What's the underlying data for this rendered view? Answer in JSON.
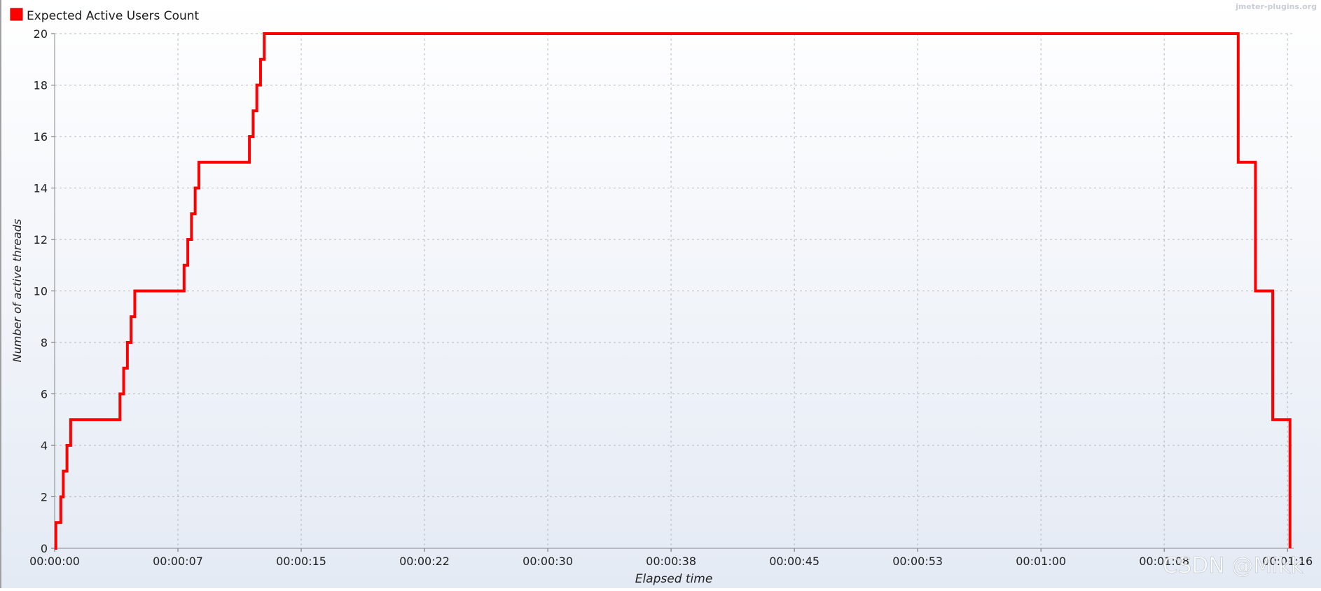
{
  "legend": {
    "label": "Expected Active Users Count",
    "color": "#ff0000"
  },
  "watermark_top": "jmeter-plugins.org",
  "watermark_bottom": "CSDN @Mikk",
  "chart_data": {
    "type": "line",
    "series": [
      {
        "name": "Expected Active Users Count",
        "color": "#ff0000",
        "step": true,
        "points": [
          [
            0,
            0
          ],
          [
            0.1,
            1
          ],
          [
            0.5,
            2
          ],
          [
            0.7,
            3
          ],
          [
            1.0,
            4
          ],
          [
            1.3,
            5
          ],
          [
            5.3,
            6
          ],
          [
            5.6,
            7
          ],
          [
            5.9,
            8
          ],
          [
            6.2,
            9
          ],
          [
            6.5,
            10
          ],
          [
            10.5,
            11
          ],
          [
            10.8,
            12
          ],
          [
            11.1,
            13
          ],
          [
            11.4,
            14
          ],
          [
            11.7,
            15
          ],
          [
            15.8,
            16
          ],
          [
            16.1,
            17
          ],
          [
            16.4,
            18
          ],
          [
            16.7,
            19
          ],
          [
            17.0,
            20
          ],
          [
            96.0,
            15
          ],
          [
            97.4,
            10
          ],
          [
            98.8,
            5
          ],
          [
            100.2,
            0
          ]
        ]
      }
    ],
    "x_unit": "seconds",
    "xlabel": "Elapsed time",
    "ylabel": "Number of active threads",
    "xlim": [
      0,
      100.5
    ],
    "ylim": [
      0,
      20
    ],
    "x_ticks": [
      {
        "value": 0,
        "label": "00:00:00"
      },
      {
        "value": 10,
        "label": "00:00:07"
      },
      {
        "value": 20,
        "label": "00:00:15"
      },
      {
        "value": 30,
        "label": "00:00:22"
      },
      {
        "value": 40,
        "label": "00:00:30"
      },
      {
        "value": 50,
        "label": "00:00:38"
      },
      {
        "value": 60,
        "label": "00:00:45"
      },
      {
        "value": 70,
        "label": "00:00:53"
      },
      {
        "value": 80,
        "label": "00:01:00"
      },
      {
        "value": 90,
        "label": "00:01:08"
      },
      {
        "value": 100,
        "label": "00:01:16"
      }
    ],
    "y_ticks": [
      0,
      2,
      4,
      6,
      8,
      10,
      12,
      14,
      16,
      18,
      20
    ],
    "grid": true,
    "legend_position": "top-left"
  }
}
